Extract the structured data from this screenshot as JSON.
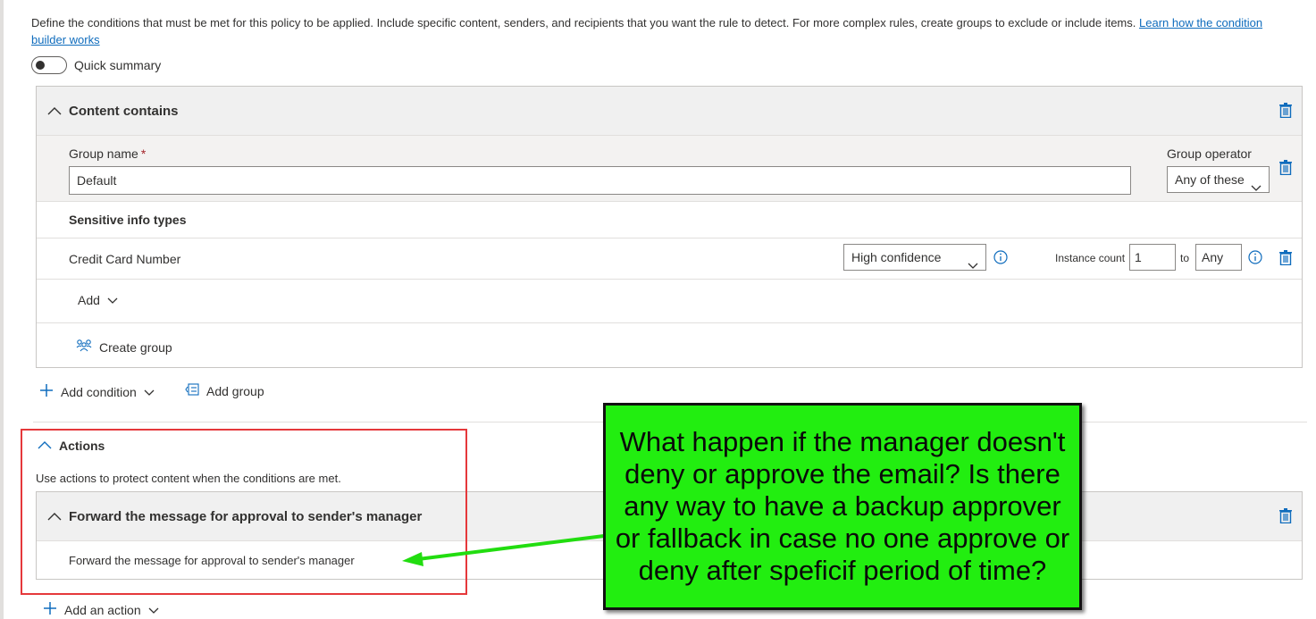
{
  "intro": {
    "text": "Define the conditions that must be met for this policy to be applied. Include specific content, senders, and recipients that you want the rule to detect. For more complex rules, create groups to exclude or include items. ",
    "link": "Learn how the condition builder works"
  },
  "quick_summary": {
    "label": "Quick summary",
    "on": false
  },
  "conditions": {
    "title": "Content contains",
    "group_name_label": "Group name",
    "required_marker": "*",
    "group_name_value": "Default",
    "group_operator_label": "Group operator",
    "group_operator_value": "Any of these",
    "sensitive_info_title": "Sensitive info types",
    "info_type": {
      "name": "Credit Card Number",
      "confidence": "High confidence",
      "instance_label": "Instance count",
      "instance_from": "1",
      "to_label": "to",
      "instance_to": "Any"
    },
    "add_label": "Add",
    "create_group_label": "Create group"
  },
  "footer_buttons": {
    "add_condition": "Add condition",
    "add_group": "Add group"
  },
  "actions": {
    "title": "Actions",
    "description": "Use actions to protect content when the conditions are met.",
    "action_title": "Forward the message for approval to sender's manager",
    "action_body": "Forward the message for approval to sender's manager",
    "add_action": "Add an action"
  },
  "annotation": {
    "callout_text": "What happen if the manager doesn't deny or approve the email? Is there any way to have a backup approver or fallback in case no one approve or deny after speficif period of time?",
    "callout_color": "#22ee10",
    "highlight_color": "#e5383b"
  },
  "colors": {
    "accent": "#0f6cbd"
  }
}
